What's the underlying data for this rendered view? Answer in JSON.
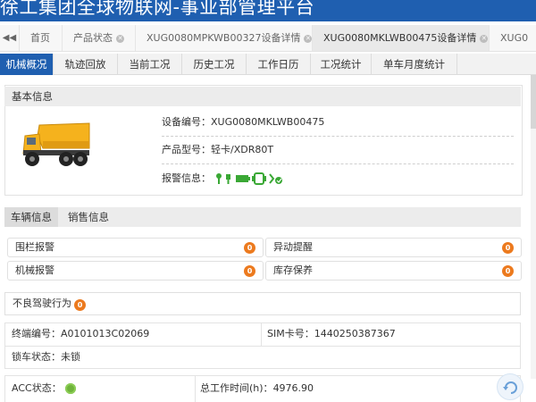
{
  "app_title": "徐工集团全球物联网-事业部管理平台",
  "page_tabs": [
    {
      "label": "首页",
      "closable": false
    },
    {
      "label": "产品状态",
      "closable": true
    },
    {
      "label": "XUG0080MPKWB00327设备详情",
      "closable": true
    },
    {
      "label": "XUG0080MKLWB00475设备详情",
      "closable": true,
      "active": true
    },
    {
      "label": "XUG0",
      "closable": false
    }
  ],
  "sub_nav": [
    "机械概况",
    "轨迹回放",
    "当前工况",
    "历史工况",
    "工作日历",
    "工况统计",
    "单车月度统计"
  ],
  "basic": {
    "heading": "基本信息",
    "device_no_label": "设备编号：",
    "device_no": "XUG0080MKLWB00475",
    "model_label": "产品型号：",
    "model": "轻卡/XDR80T",
    "alarm_label": "报警信息："
  },
  "vehicle_tabs": [
    "车辆信息",
    "销售信息"
  ],
  "alarms": [
    {
      "label": "围栏报警",
      "count": "0"
    },
    {
      "label": "异动提醒",
      "count": "0"
    },
    {
      "label": "机械报警",
      "count": "0"
    },
    {
      "label": "库存保养",
      "count": "0"
    }
  ],
  "bad_driving": {
    "label": "不良驾驶行为",
    "count": "0"
  },
  "details": {
    "terminal_label": "终端编号：",
    "terminal": "A0101013C02069",
    "sim_label": "SIM卡号：",
    "sim": "1440250387367",
    "lock_label": "锁车状态：",
    "lock": "未锁",
    "acc_label": "ACC状态：",
    "total_label": "总工作时间(h)：",
    "total": "4976.90"
  },
  "colors": {
    "header": "#1f5fb0",
    "badge": "#ec7a1e",
    "acc_on": "#6fb33c",
    "alarm_icon": "#3aa835"
  }
}
